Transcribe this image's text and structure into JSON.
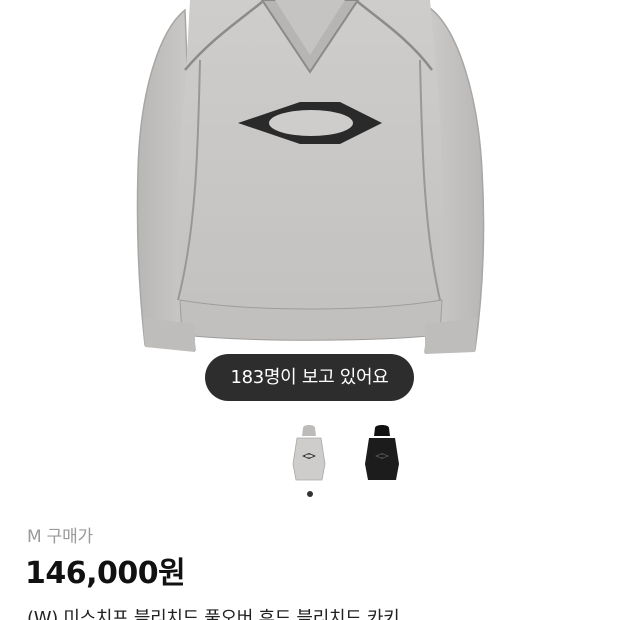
{
  "product": {
    "image_icon": "gray-washed-sweatshirt-image",
    "viewer_badge": "183명이 보고 있어요",
    "thumbnails": [
      {
        "icon": "gray-hoodie-thumbnail",
        "color": "#c9c7c5"
      },
      {
        "icon": "black-hoodie-thumbnail",
        "color": "#1c1c1c"
      }
    ],
    "carousel_position": 1,
    "price_label": "M 구매가",
    "price": "146,000원",
    "title": "(W) 미스치프 블리치드 풀오버 후드 블리치드 카키"
  },
  "colors": {
    "badge_bg": "#2d2d2d",
    "price_label": "#9a9a9a",
    "text": "#111111"
  }
}
